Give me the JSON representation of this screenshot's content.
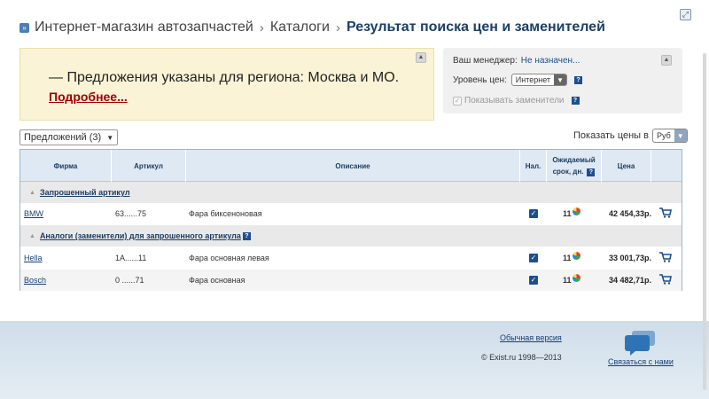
{
  "breadcrumb": {
    "items": [
      "Интернет-магазин автозапчастей",
      "Каталоги"
    ],
    "current": "Результат поиска цен и заменителей",
    "separator": "›"
  },
  "notice": {
    "text": "— Предложения указаны для региона: Москва и МО.",
    "more_link": "Подробнее..."
  },
  "manager": {
    "label": "Ваш менеджер:",
    "value": "Не назначен...",
    "price_level_label": "Уровень цен:",
    "price_level_value": "Интернет",
    "show_substitutes_label": "Показывать заменители"
  },
  "offers_select": "Предложений (3)",
  "price_ctl": {
    "label": "Показать цены в",
    "currency": "Руб"
  },
  "table": {
    "headers": {
      "brand": "Фирма",
      "article": "Артикул",
      "description": "Описание",
      "stock": "Нал.",
      "expected_1": "Ожидаемый",
      "expected_2": "срок, дн.",
      "price": "Цена"
    },
    "section_requested": "Запрошенный артикул",
    "section_analogs": "Аналоги (заменители) для запрошенного артикула",
    "rows": [
      {
        "brand": "BMW",
        "article": "63......75",
        "description": "Фара биксеноновая",
        "days": "11",
        "price": "42 454,33р."
      },
      {
        "brand": "Hella",
        "article": "1A......11",
        "description": "Фара основная левая",
        "days": "11",
        "price": "33 001,73р."
      },
      {
        "brand": "Bosch",
        "article": "0 ......71",
        "description": "Фара основная",
        "days": "11",
        "price": "34 482,71р."
      }
    ]
  },
  "footer": {
    "classic_version": "Обычная версия",
    "copyright": "© Exist.ru 1998—2013",
    "contact": "Связаться с нами"
  },
  "colors": {
    "header_bg": "#dfe9f3",
    "accent": "#1d4f8f",
    "notice_bg": "#fbf3d5",
    "more_link": "#a00000"
  }
}
